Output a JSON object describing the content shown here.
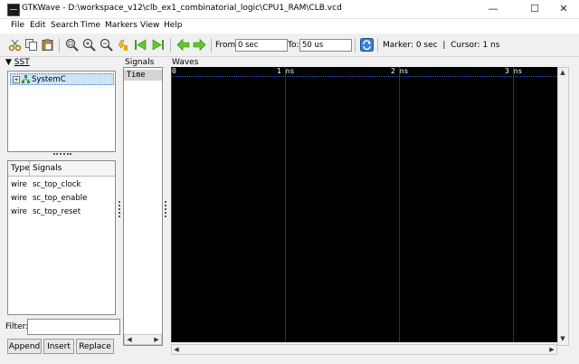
{
  "window": {
    "app_name": "GTKWave",
    "title": "GTKWave - D:\\workspace_v12\\clb_ex1_combinatorial_logic\\CPU1_RAM\\CLB.vcd",
    "minimize": "—",
    "maximize": "☐",
    "close": "✕"
  },
  "menu": [
    "File",
    "Edit",
    "Search",
    "Time",
    "Markers",
    "View",
    "Help"
  ],
  "toolbar": {
    "from_label": "From:",
    "from_value": "0 sec",
    "to_label": "To:",
    "to_value": "50 us",
    "marker_text": "Marker: 0 sec",
    "separator": "|",
    "cursor_text": "Cursor: 1 ns"
  },
  "sst": {
    "header": "SST",
    "tree": [
      {
        "label": "SystemC",
        "expander": "+"
      }
    ]
  },
  "signals_table": {
    "col_type": "Type",
    "col_signals": "Signals",
    "rows": [
      {
        "type": "wire",
        "name": "sc_top_clock"
      },
      {
        "type": "wire",
        "name": "sc_top_enable"
      },
      {
        "type": "wire",
        "name": "sc_top_reset"
      }
    ]
  },
  "filter": {
    "label": "Filter:",
    "value": ""
  },
  "buttons": {
    "append": "Append",
    "insert": "Insert",
    "replace": "Replace"
  },
  "signals_pane": {
    "title": "Signals",
    "time_row": "Time"
  },
  "waves_pane": {
    "title": "Waves",
    "ruler": [
      "0",
      "1 ns",
      "2 ns",
      "3 ns"
    ],
    "background": "#000000",
    "grid_color": "#1e2f7a"
  }
}
